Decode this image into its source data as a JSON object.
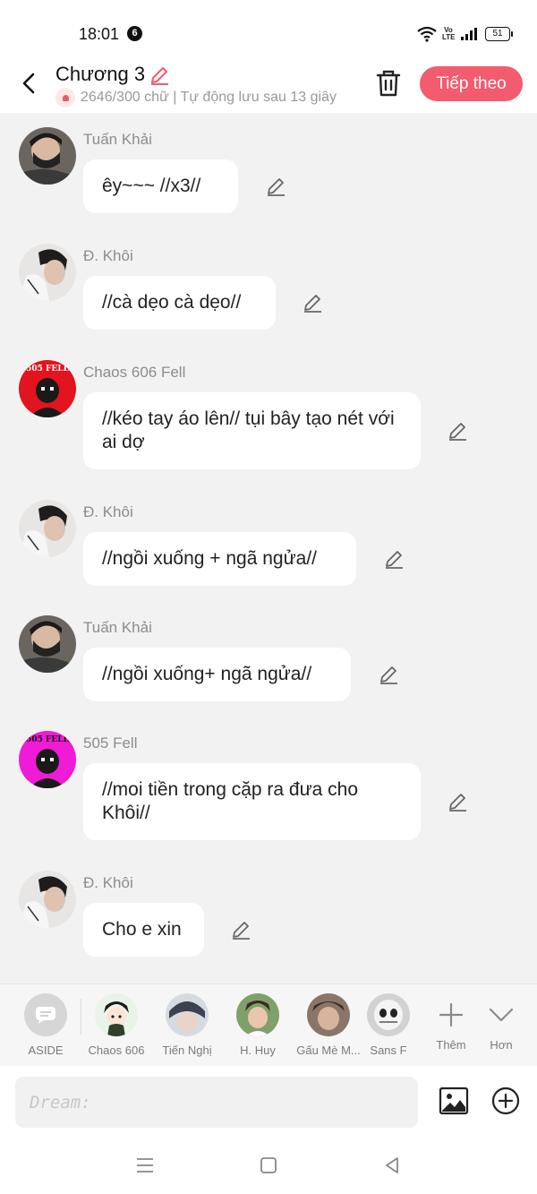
{
  "status_bar": {
    "time": "18:01",
    "notification_count": "6",
    "volte_top": "Vo",
    "volte_bottom": "LTE",
    "battery": "51"
  },
  "header": {
    "title": "Chương 3",
    "subtitle": "2646/300 chữ | Tự động lưu sau 13 giây",
    "next_label": "Tiếp theo",
    "accent_color": "#f35b6f"
  },
  "messages": [
    {
      "name": "Tuấn Khải",
      "text": "êy~~~ //x3//",
      "avatar": "tuan-khai"
    },
    {
      "name": "Đ. Khôi",
      "text": "//cà dẹo cà dẹo//",
      "avatar": "d-khoi"
    },
    {
      "name": "Chaos 606 Fell",
      "text": "//kéo tay áo lên// tụi bây tạo nét với ai dợ",
      "avatar": "chaos-606-fell",
      "avatar_text": "505 FELL"
    },
    {
      "name": "Đ. Khôi",
      "text": "//ngồi xuống + ngã ngửa//",
      "avatar": "d-khoi"
    },
    {
      "name": "Tuấn Khải",
      "text": "//ngồi xuống+ ngã ngửa//",
      "avatar": "tuan-khai"
    },
    {
      "name": "505 Fell",
      "text": "//moi tiền trong cặp ra đưa cho Khôi//",
      "avatar": "505-fell",
      "avatar_text": "505 FELL"
    },
    {
      "name": "Đ. Khôi",
      "text": "Cho e xin",
      "avatar": "d-khoi"
    }
  ],
  "characters": [
    {
      "label": "ASIDE",
      "icon": "chat-bubble-icon"
    },
    {
      "label": "Chaos 606"
    },
    {
      "label": "Tiến Nghị"
    },
    {
      "label": "H. Huy"
    },
    {
      "label": "Gấu Mè M..."
    },
    {
      "label": "Sans F"
    }
  ],
  "strip_actions": {
    "more_label": "Thêm",
    "expand_label": "Hơn"
  },
  "input": {
    "placeholder": "Dream:"
  }
}
